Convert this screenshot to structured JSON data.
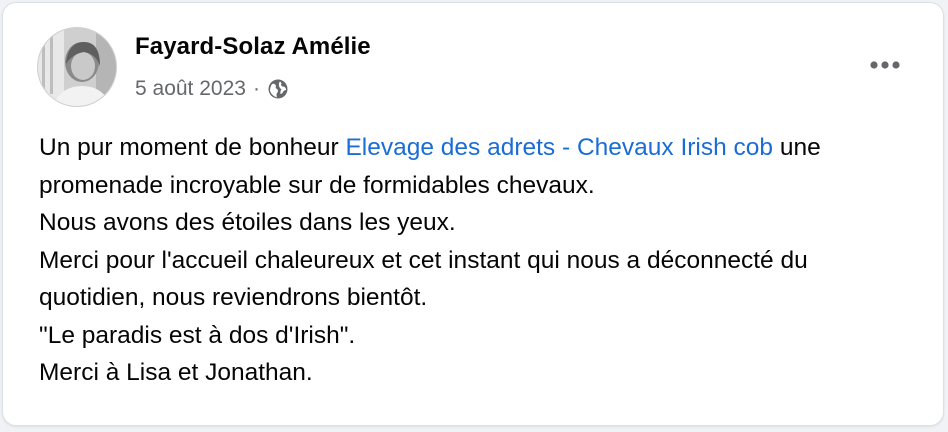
{
  "post": {
    "author": "Fayard-Solaz Amélie",
    "date": "5 août 2023",
    "separator": "·",
    "audience_icon": "globe-icon",
    "more_icon": "more-options-icon",
    "avatar": "avatar-photo",
    "text": {
      "line1_prefix": "Un pur moment de bonheur ",
      "tagged_page": "Elevage des adrets - Chevaux Irish cob",
      "line1_suffix": " une promenade incroyable sur de formidables chevaux.",
      "line2": "Nous avons des étoiles dans les yeux.",
      "line3": "Merci pour l'accueil chaleureux et cet instant qui nous a déconnecté du quotidien, nous reviendrons bientôt.",
      "line4": "\"Le paradis est à dos d'Irish\".",
      "line5": "Merci à Lisa et Jonathan."
    }
  },
  "colors": {
    "link": "#1b6dd6",
    "text": "#050505",
    "muted": "#65676b"
  }
}
